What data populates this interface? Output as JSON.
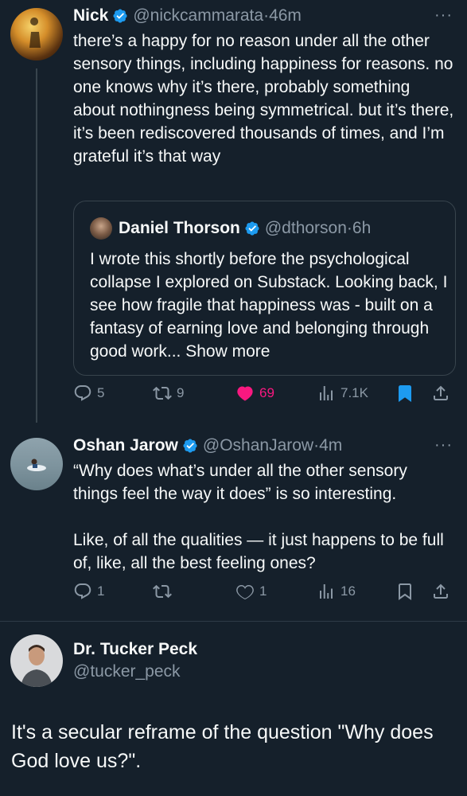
{
  "tweet1": {
    "name": "Nick",
    "handle": "@nickcammarata",
    "time": "46m",
    "more": "···",
    "text": "there’s a happy for no reason under all the other sensory things, including happiness for reasons. no one knows why it’s there, probably something about nothingness being symmetrical. but it’s there, it’s been rediscovered thousands of times, and I’m grateful it’s that way",
    "quote": {
      "name": "Daniel Thorson",
      "handle": "@dthorson",
      "time": "6h",
      "text": "I wrote this shortly before the psychological collapse I explored on Substack. Looking back, I see how fragile that happiness was - built on a fantasy of earning love and belonging through good work...",
      "show_more": "Show more"
    },
    "actions": {
      "replies": "5",
      "retweets": "9",
      "likes": "69",
      "views": "7.1K"
    },
    "colors": {
      "like": "#f91880",
      "bookmark": "#1d9bf0"
    }
  },
  "tweet2": {
    "name": "Oshan Jarow",
    "handle": "@OshanJarow",
    "time": "4m",
    "more": "···",
    "text1": "“Why does what’s under all the other sensory things feel the way it does” is so interesting.",
    "text2": "Like, of all the qualities — it just happens to be full of, like, all the best feeling ones?",
    "actions": {
      "replies": "1",
      "retweets": "",
      "likes": "1",
      "views": "16"
    }
  },
  "tweet3": {
    "name": "Dr. Tucker Peck",
    "handle": "@tucker_peck",
    "text": "It's a secular reframe of the question \"Why does God love us?\"."
  },
  "icons": {
    "verified": "verified-badge-icon",
    "reply": "reply-icon",
    "retweet": "retweet-icon",
    "like": "heart-icon",
    "views": "views-icon",
    "bookmark": "bookmark-icon",
    "share": "share-icon"
  }
}
